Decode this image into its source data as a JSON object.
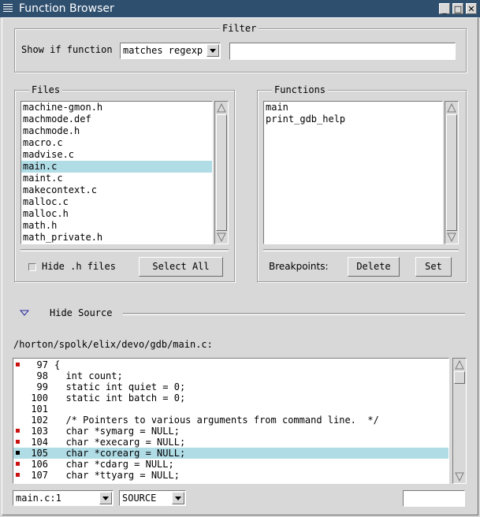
{
  "window": {
    "title": "Function Browser"
  },
  "filter": {
    "legend": "Filter",
    "label": "Show if function",
    "mode": "matches regexp",
    "pattern": ""
  },
  "files": {
    "legend": "Files",
    "items": [
      "machine-gmon.h",
      "machmode.def",
      "machmode.h",
      "macro.c",
      "madvise.c",
      "main.c",
      "maint.c",
      "makecontext.c",
      "malloc.c",
      "malloc.h",
      "math.h",
      "math_private.h"
    ],
    "selected": "main.c",
    "hide_h_label": "Hide .h files",
    "hide_h_checked": false,
    "select_all_label": "Select All"
  },
  "functions": {
    "legend": "Functions",
    "items": [
      "main",
      "print_gdb_help"
    ],
    "breakpoints_label": "Breakpoints:",
    "delete_label": "Delete",
    "set_label": "Set"
  },
  "source_toggle": {
    "label": "Hide Source"
  },
  "source": {
    "path": "/horton/spolk/elix/devo/gdb/main.c:",
    "lines": [
      {
        "num": "97",
        "code": "{",
        "bp": true,
        "current": false
      },
      {
        "num": "98",
        "code": "  int count;",
        "bp": false,
        "current": false
      },
      {
        "num": "99",
        "code": "  static int quiet = 0;",
        "bp": false,
        "current": false
      },
      {
        "num": "100",
        "code": "  static int batch = 0;",
        "bp": false,
        "current": false
      },
      {
        "num": "101",
        "code": "",
        "bp": false,
        "current": false
      },
      {
        "num": "102",
        "code": "  /* Pointers to various arguments from command line.  */",
        "bp": false,
        "current": false
      },
      {
        "num": "103",
        "code": "  char *symarg = NULL;",
        "bp": true,
        "current": false
      },
      {
        "num": "104",
        "code": "  char *execarg = NULL;",
        "bp": true,
        "current": false
      },
      {
        "num": "105",
        "code": "  char *corearg = NULL;",
        "bp": true,
        "current": true
      },
      {
        "num": "106",
        "code": "  char *cdarg = NULL;",
        "bp": true,
        "current": false
      },
      {
        "num": "107",
        "code": "  char *ttyarg = NULL;",
        "bp": true,
        "current": false
      }
    ]
  },
  "statusbar": {
    "location": "main.c:1",
    "view_mode": "SOURCE",
    "entry": ""
  },
  "colors": {
    "selection": "#b0dce6",
    "breakpoint": "#cc1111",
    "titlebar": "#2f4f6f"
  }
}
